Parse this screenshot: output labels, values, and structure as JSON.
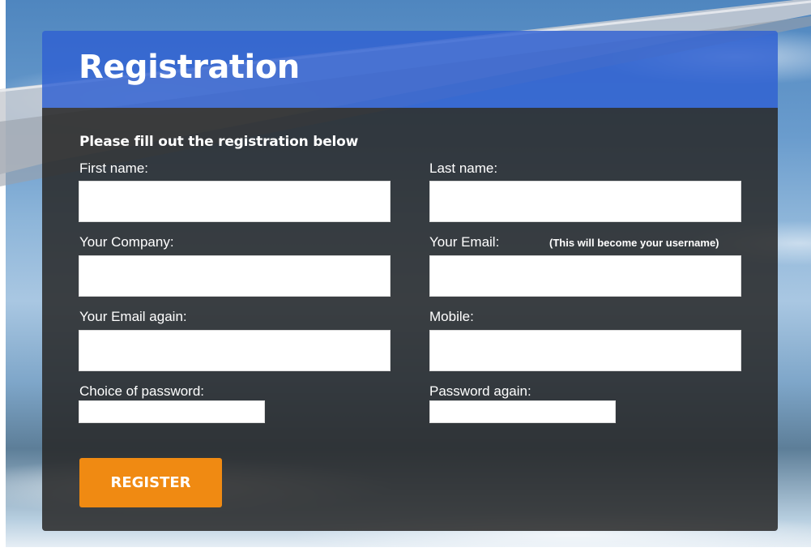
{
  "form": {
    "title": "Registration",
    "subtitle": "Please fill out the registration below",
    "fields": {
      "first_name": {
        "label": "First name:",
        "value": ""
      },
      "last_name": {
        "label": "Last name:",
        "value": ""
      },
      "company": {
        "label": "Your Company:",
        "value": ""
      },
      "email": {
        "label": "Your Email:",
        "note": "(This will become your username)",
        "value": ""
      },
      "email_again": {
        "label": "Your Email again:",
        "value": ""
      },
      "mobile": {
        "label": "Mobile:",
        "value": ""
      },
      "password": {
        "label": "Choice of password:",
        "value": ""
      },
      "password_again": {
        "label": "Password again:",
        "value": ""
      }
    },
    "register_label": "REGISTER"
  },
  "colors": {
    "header": "#3060d2",
    "body": "#282828",
    "button": "#f08a12",
    "text": "#ffffff"
  }
}
